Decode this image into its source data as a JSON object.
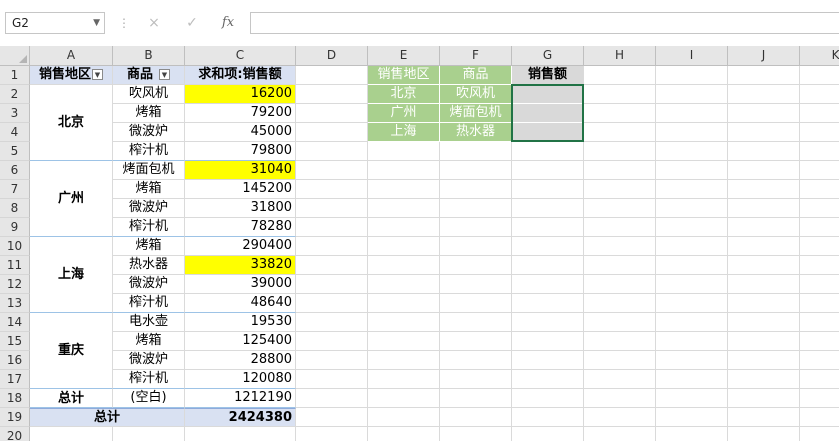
{
  "formula_bar": {
    "name_box": "G2",
    "separator_icon": "vertical-dots-icon",
    "cancel_icon": "×",
    "enter_icon": "✓",
    "fx_label": "fx",
    "formula_value": ""
  },
  "columns": [
    "A",
    "B",
    "C",
    "D",
    "E",
    "F",
    "G",
    "H",
    "I",
    "J",
    "K"
  ],
  "rows": [
    "1",
    "2",
    "3",
    "4",
    "5",
    "6",
    "7",
    "8",
    "9",
    "10",
    "11",
    "12",
    "13",
    "14",
    "15",
    "16",
    "17",
    "18",
    "19",
    "20"
  ],
  "pivot": {
    "header_region": "销售地区",
    "header_product": "商品",
    "header_sum": "求和项:销售额",
    "groups": [
      {
        "region": "北京",
        "items": [
          {
            "product": "吹风机",
            "value": "16200"
          },
          {
            "product": "烤箱",
            "value": "79200"
          },
          {
            "product": "微波炉",
            "value": "45000"
          },
          {
            "product": "榨汁机",
            "value": "79800"
          }
        ]
      },
      {
        "region": "广州",
        "items": [
          {
            "product": "烤面包机",
            "value": "31040"
          },
          {
            "product": "烤箱",
            "value": "145200"
          },
          {
            "product": "微波炉",
            "value": "31800"
          },
          {
            "product": "榨汁机",
            "value": "78280"
          }
        ]
      },
      {
        "region": "上海",
        "items": [
          {
            "product": "烤箱",
            "value": "290400"
          },
          {
            "product": "热水器",
            "value": "33820"
          },
          {
            "product": "微波炉",
            "value": "39000"
          },
          {
            "product": "榨汁机",
            "value": "48640"
          }
        ]
      },
      {
        "region": "重庆",
        "items": [
          {
            "product": "电水壶",
            "value": "19530"
          },
          {
            "product": "烤箱",
            "value": "125400"
          },
          {
            "product": "微波炉",
            "value": "28800"
          },
          {
            "product": "榨汁机",
            "value": "120080"
          }
        ]
      },
      {
        "region": "总计",
        "items": [
          {
            "product": "(空白)",
            "value": "1212190"
          }
        ]
      }
    ],
    "grand_total_label": "总计",
    "grand_total_value": "2424380",
    "highlight_color": "#ffff00"
  },
  "lookup": {
    "header_region": "销售地区",
    "header_product": "商品",
    "header_sales": "销售额",
    "rows": [
      {
        "region": "北京",
        "product": "吹风机"
      },
      {
        "region": "广州",
        "product": "烤面包机"
      },
      {
        "region": "上海",
        "product": "热水器"
      }
    ],
    "green_color": "#a9d08e",
    "header_gray": "#d9d9d9"
  }
}
